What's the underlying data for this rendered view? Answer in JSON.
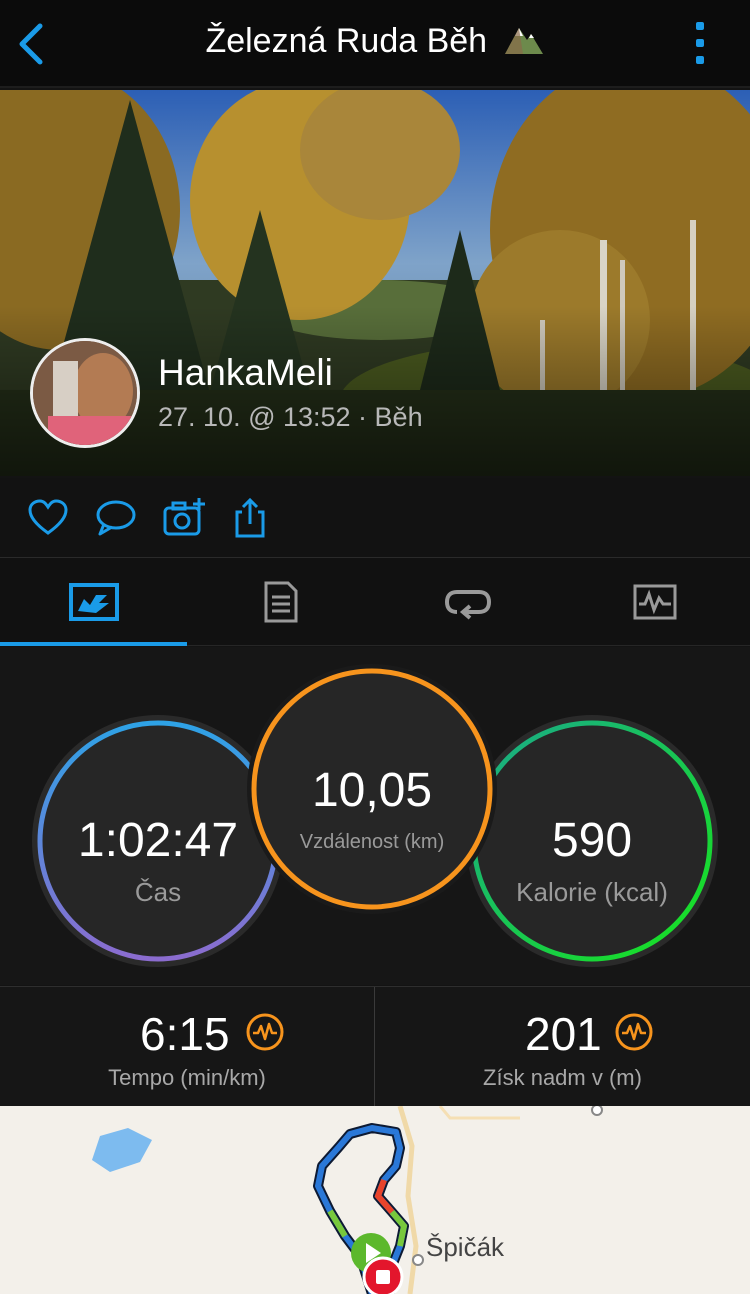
{
  "header": {
    "title": "Železná Ruda Běh",
    "title_icon": "mountain-icon",
    "back_icon": "chevron-left-icon",
    "menu_icon": "kebab-menu-icon"
  },
  "hero": {
    "username": "HankaMeli",
    "meta": "27. 10. @ 13:52 · Běh"
  },
  "actions": [
    {
      "icon": "heart-icon"
    },
    {
      "icon": "comment-icon"
    },
    {
      "icon": "add-photo-icon"
    },
    {
      "icon": "share-icon"
    }
  ],
  "tabs": [
    {
      "icon": "overview-icon",
      "active": true
    },
    {
      "icon": "details-icon",
      "active": false
    },
    {
      "icon": "laps-icon",
      "active": false
    },
    {
      "icon": "charts-icon",
      "active": false
    }
  ],
  "stats": {
    "time": {
      "value": "1:02:47",
      "label": "Čas"
    },
    "distance": {
      "value": "10,05",
      "label": "Vzdálenost (km)"
    },
    "calories": {
      "value": "590",
      "label": "Kalorie (kcal)"
    }
  },
  "metrics": {
    "pace": {
      "value": "6:15",
      "label": "Tempo (min/km)",
      "icon": "pulse-icon"
    },
    "elevation": {
      "value": "201",
      "label": "Získ nadm v (m)",
      "icon": "pulse-icon"
    }
  },
  "map": {
    "place_label": "Špičák",
    "start_icon": "play-icon",
    "end_icon": "stop-icon"
  },
  "colors": {
    "accent": "#1a9be8",
    "distance_ring": "#f7941d",
    "metric_icon": "#f7941d"
  }
}
